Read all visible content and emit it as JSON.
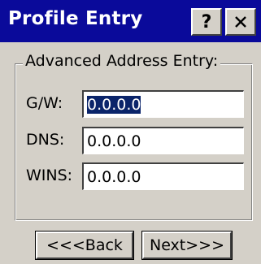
{
  "window": {
    "title": "Profile Entry",
    "help_label": "?",
    "close_icon": "close-icon"
  },
  "group": {
    "legend": "Advanced Address Entry:"
  },
  "fields": [
    {
      "label": "G/W:",
      "value": "0.0.0.0",
      "selected": true
    },
    {
      "label": "DNS:",
      "value": "0.0.0.0",
      "selected": false
    },
    {
      "label": "WINS:",
      "value": "0.0.0.0",
      "selected": false
    }
  ],
  "buttons": {
    "back_label": "<<<Back",
    "next_label": "Next>>>"
  },
  "colors": {
    "titlebar": "#0a0a9a",
    "face": "#d4d0c8",
    "selection": "#0a246a"
  }
}
